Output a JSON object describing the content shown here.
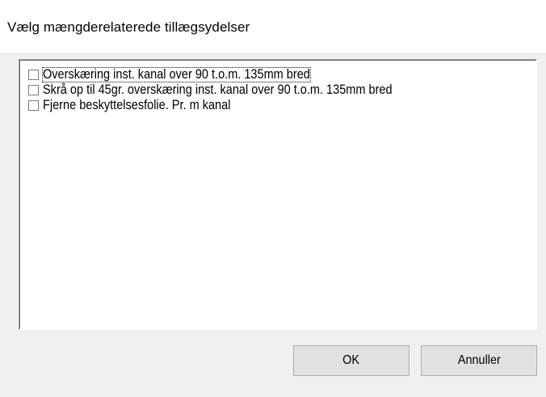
{
  "dialog": {
    "title": "Vælg mængderelaterede tillægsydelser"
  },
  "list": {
    "items": [
      {
        "label": "Overskæring inst. kanal over 90 t.o.m. 135mm bred",
        "checked": false,
        "focused": true
      },
      {
        "label": "Skrå op til 45gr. overskæring inst. kanal over 90 t.o.m. 135mm bred",
        "checked": false,
        "focused": false
      },
      {
        "label": "Fjerne beskyttelsesfolie. Pr. m kanal",
        "checked": false,
        "focused": false
      }
    ]
  },
  "buttons": {
    "ok_label": "OK",
    "cancel_label": "Annuller"
  }
}
